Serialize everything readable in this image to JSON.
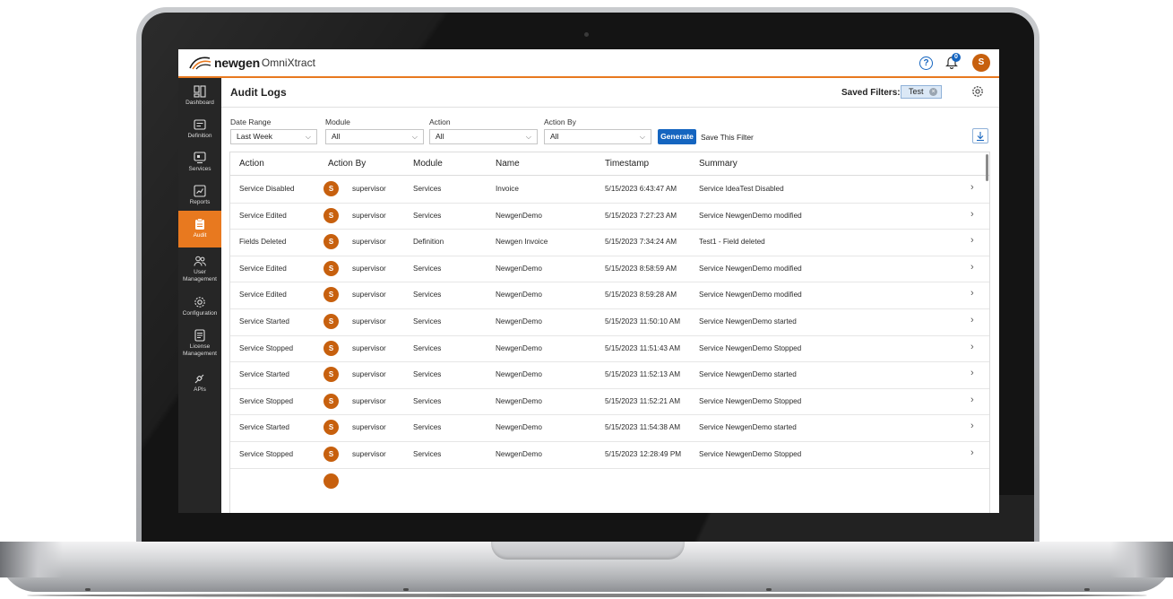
{
  "app": {
    "brand_bold": "newgen",
    "brand_light": "OmniXtract",
    "help_glyph": "?",
    "notification_count": "0",
    "user_initial": "S",
    "accent_color": "#e8791f",
    "primary_color": "#1565c0",
    "avatar_color": "#c7600e"
  },
  "sidebar": {
    "items": [
      {
        "label": "Dashboard",
        "icon": "dashboard-icon"
      },
      {
        "label": "Definition",
        "icon": "definition-icon"
      },
      {
        "label": "Services",
        "icon": "services-icon"
      },
      {
        "label": "Reports",
        "icon": "reports-icon"
      },
      {
        "label": "Audit",
        "icon": "audit-icon",
        "active": true
      },
      {
        "label": "User Management",
        "icon": "user-management-icon"
      },
      {
        "label": "Configuration",
        "icon": "configuration-icon"
      },
      {
        "label": "License Management",
        "icon": "license-icon"
      },
      {
        "label": "APIs",
        "icon": "api-icon"
      }
    ]
  },
  "page": {
    "title": "Audit Logs",
    "saved_filters_label": "Saved Filters:",
    "saved_filter_chip": "Test"
  },
  "filters": {
    "date_range": {
      "label": "Date Range",
      "value": "Last Week"
    },
    "module": {
      "label": "Module",
      "value": "All"
    },
    "action": {
      "label": "Action",
      "value": "All"
    },
    "action_by": {
      "label": "Action By",
      "value": "All"
    },
    "generate_label": "Generate",
    "save_filter_label": "Save This Filter"
  },
  "table": {
    "headers": [
      "Action",
      "Action By",
      "Module",
      "Name",
      "Timestamp",
      "Summary"
    ],
    "rows": [
      {
        "action": "Service Disabled",
        "initial": "S",
        "by": "supervisor",
        "module": "Services",
        "name": "Invoice",
        "timestamp": "5/15/2023 6:43:47 AM",
        "summary": "Service IdeaTest Disabled"
      },
      {
        "action": "Service Edited",
        "initial": "S",
        "by": "supervisor",
        "module": "Services",
        "name": "NewgenDemo",
        "timestamp": "5/15/2023 7:27:23 AM",
        "summary": "Service NewgenDemo modified"
      },
      {
        "action": "Fields Deleted",
        "initial": "S",
        "by": "supervisor",
        "module": "Definition",
        "name": "Newgen Invoice",
        "timestamp": "5/15/2023 7:34:24 AM",
        "summary": "Test1 - Field deleted"
      },
      {
        "action": "Service Edited",
        "initial": "S",
        "by": "supervisor",
        "module": "Services",
        "name": "NewgenDemo",
        "timestamp": "5/15/2023 8:58:59 AM",
        "summary": "Service NewgenDemo modified"
      },
      {
        "action": "Service Edited",
        "initial": "S",
        "by": "supervisor",
        "module": "Services",
        "name": "NewgenDemo",
        "timestamp": "5/15/2023 8:59:28 AM",
        "summary": "Service NewgenDemo modified"
      },
      {
        "action": "Service Started",
        "initial": "S",
        "by": "supervisor",
        "module": "Services",
        "name": "NewgenDemo",
        "timestamp": "5/15/2023 11:50:10 AM",
        "summary": "Service NewgenDemo started"
      },
      {
        "action": "Service Stopped",
        "initial": "S",
        "by": "supervisor",
        "module": "Services",
        "name": "NewgenDemo",
        "timestamp": "5/15/2023 11:51:43 AM",
        "summary": "Service NewgenDemo Stopped"
      },
      {
        "action": "Service Started",
        "initial": "S",
        "by": "supervisor",
        "module": "Services",
        "name": "NewgenDemo",
        "timestamp": "5/15/2023 11:52:13 AM",
        "summary": "Service NewgenDemo started"
      },
      {
        "action": "Service Stopped",
        "initial": "S",
        "by": "supervisor",
        "module": "Services",
        "name": "NewgenDemo",
        "timestamp": "5/15/2023 11:52:21 AM",
        "summary": "Service NewgenDemo Stopped"
      },
      {
        "action": "Service Started",
        "initial": "S",
        "by": "supervisor",
        "module": "Services",
        "name": "NewgenDemo",
        "timestamp": "5/15/2023 11:54:38 AM",
        "summary": "Service NewgenDemo started"
      },
      {
        "action": "Service Stopped",
        "initial": "S",
        "by": "supervisor",
        "module": "Services",
        "name": "NewgenDemo",
        "timestamp": "5/15/2023 12:28:49 PM",
        "summary": "Service NewgenDemo Stopped"
      }
    ]
  }
}
